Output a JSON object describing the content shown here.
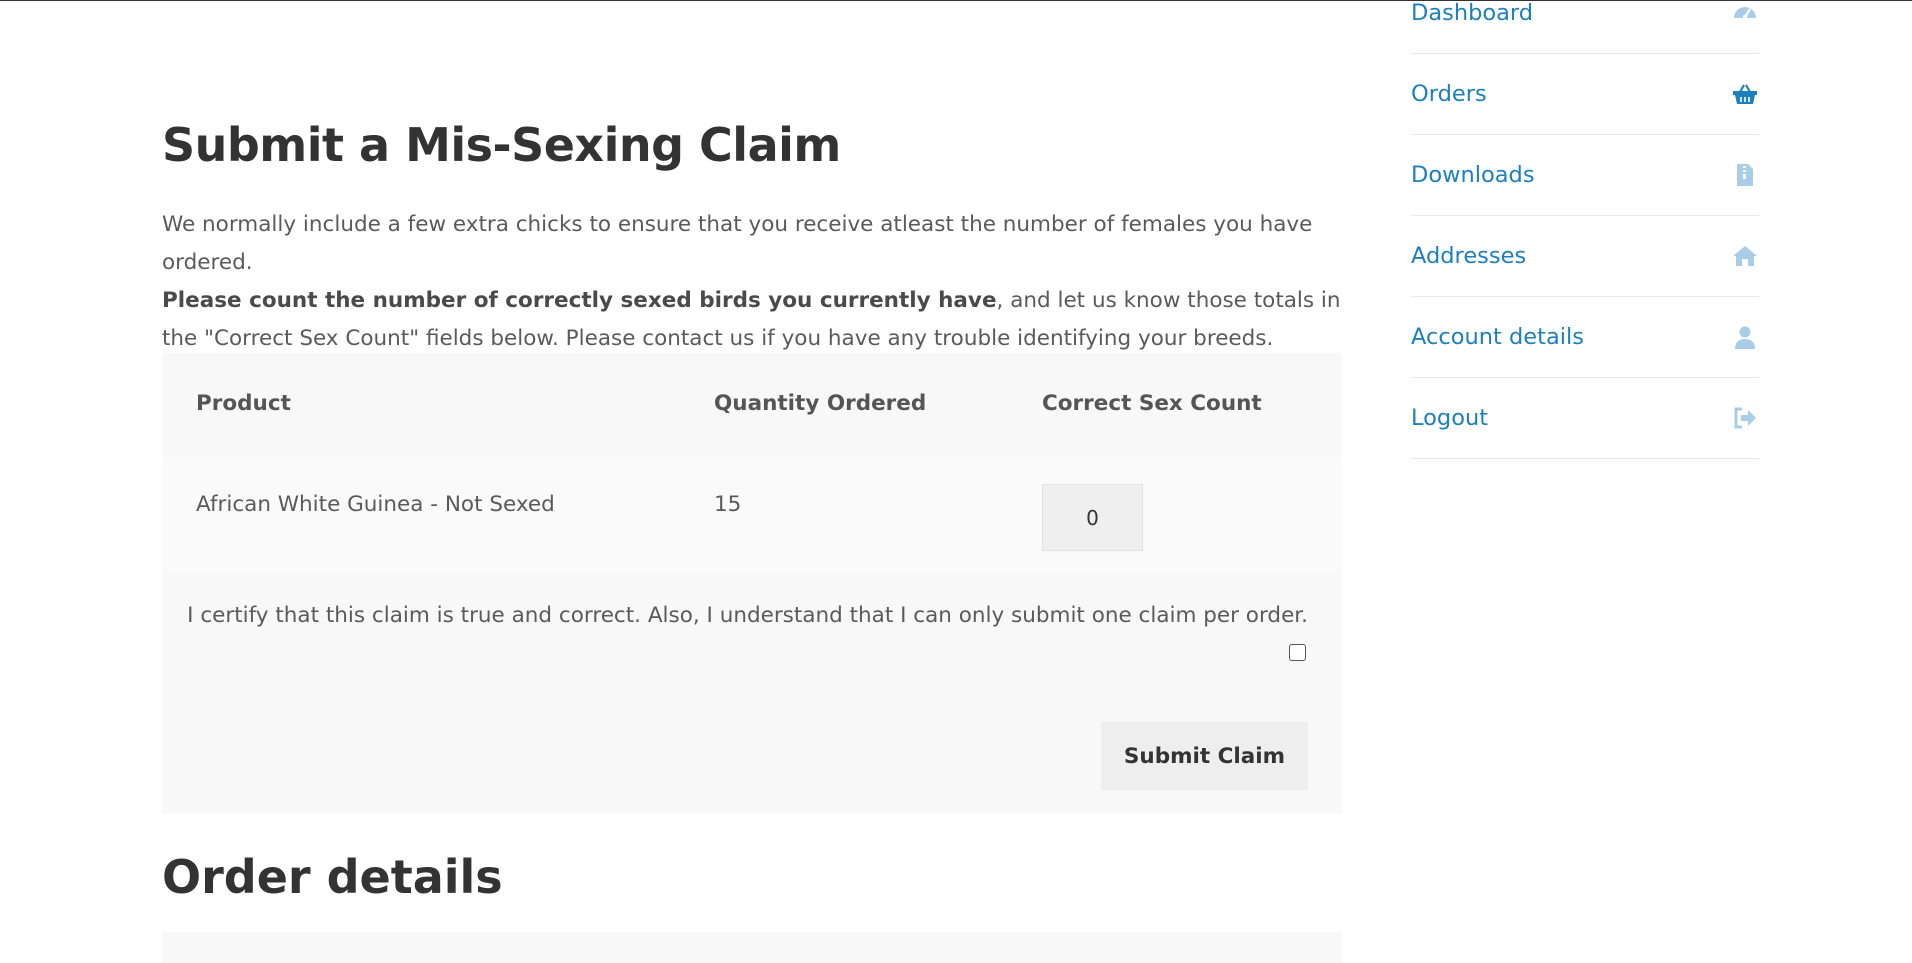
{
  "claim": {
    "title": "Submit a Mis-Sexing Claim",
    "intro_line1": "We normally include a few extra chicks to ensure that you receive atleast the number of females you have ordered.",
    "intro_bold": "Please count the number of correctly sexed birds you currently have",
    "intro_rest": ", and let us know those totals in the \"Correct Sex Count\" fields below. Please contact us if you have any trouble identifying your breeds.",
    "columns": {
      "product": "Product",
      "quantity": "Quantity Ordered",
      "correct_count": "Correct Sex Count"
    },
    "rows": [
      {
        "product": "African White Guinea - Not Sexed",
        "quantity": "15",
        "correct_count": "0"
      }
    ],
    "certify_text": "I certify that this claim is true and correct. Also, I understand that I can only submit one claim per order.",
    "certify_checked": false,
    "submit_label": "Submit Claim"
  },
  "order_details": {
    "title": "Order details"
  },
  "sidebar": {
    "items": [
      {
        "label": "Dashboard",
        "icon": "dashboard-gauge-icon",
        "active": false
      },
      {
        "label": "Orders",
        "icon": "basket-icon",
        "active": true
      },
      {
        "label": "Downloads",
        "icon": "file-archive-icon",
        "active": false
      },
      {
        "label": "Addresses",
        "icon": "home-icon",
        "active": false
      },
      {
        "label": "Account details",
        "icon": "user-icon",
        "active": false
      },
      {
        "label": "Logout",
        "icon": "sign-out-icon",
        "active": false
      }
    ]
  },
  "colors": {
    "link": "#1e7fbf",
    "icon_muted": "#a9cde6",
    "icon_active": "#1e7fbf",
    "panel_bg": "#f8f8f8"
  }
}
